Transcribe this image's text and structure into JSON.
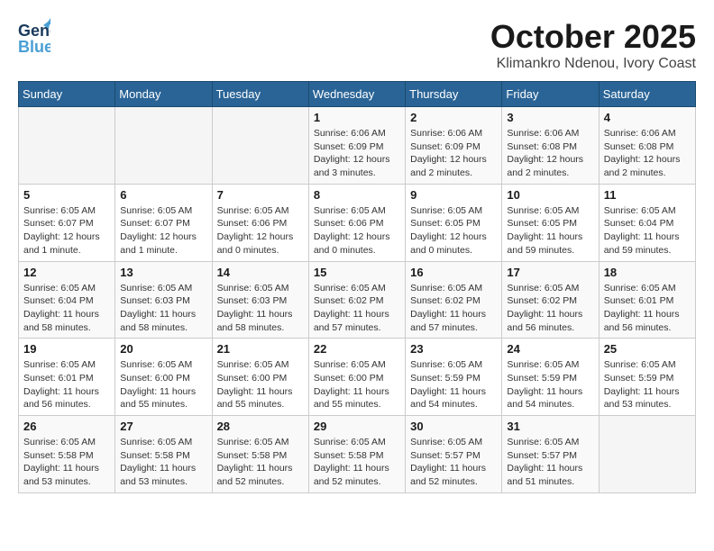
{
  "header": {
    "logo_line1": "General",
    "logo_line2": "Blue",
    "title": "October 2025",
    "subtitle": "Klimankro Ndenou, Ivory Coast"
  },
  "weekdays": [
    "Sunday",
    "Monday",
    "Tuesday",
    "Wednesday",
    "Thursday",
    "Friday",
    "Saturday"
  ],
  "weeks": [
    [
      {
        "day": "",
        "info": ""
      },
      {
        "day": "",
        "info": ""
      },
      {
        "day": "",
        "info": ""
      },
      {
        "day": "1",
        "info": "Sunrise: 6:06 AM\nSunset: 6:09 PM\nDaylight: 12 hours and 3 minutes."
      },
      {
        "day": "2",
        "info": "Sunrise: 6:06 AM\nSunset: 6:09 PM\nDaylight: 12 hours and 2 minutes."
      },
      {
        "day": "3",
        "info": "Sunrise: 6:06 AM\nSunset: 6:08 PM\nDaylight: 12 hours and 2 minutes."
      },
      {
        "day": "4",
        "info": "Sunrise: 6:06 AM\nSunset: 6:08 PM\nDaylight: 12 hours and 2 minutes."
      }
    ],
    [
      {
        "day": "5",
        "info": "Sunrise: 6:05 AM\nSunset: 6:07 PM\nDaylight: 12 hours and 1 minute."
      },
      {
        "day": "6",
        "info": "Sunrise: 6:05 AM\nSunset: 6:07 PM\nDaylight: 12 hours and 1 minute."
      },
      {
        "day": "7",
        "info": "Sunrise: 6:05 AM\nSunset: 6:06 PM\nDaylight: 12 hours and 0 minutes."
      },
      {
        "day": "8",
        "info": "Sunrise: 6:05 AM\nSunset: 6:06 PM\nDaylight: 12 hours and 0 minutes."
      },
      {
        "day": "9",
        "info": "Sunrise: 6:05 AM\nSunset: 6:05 PM\nDaylight: 12 hours and 0 minutes."
      },
      {
        "day": "10",
        "info": "Sunrise: 6:05 AM\nSunset: 6:05 PM\nDaylight: 11 hours and 59 minutes."
      },
      {
        "day": "11",
        "info": "Sunrise: 6:05 AM\nSunset: 6:04 PM\nDaylight: 11 hours and 59 minutes."
      }
    ],
    [
      {
        "day": "12",
        "info": "Sunrise: 6:05 AM\nSunset: 6:04 PM\nDaylight: 11 hours and 58 minutes."
      },
      {
        "day": "13",
        "info": "Sunrise: 6:05 AM\nSunset: 6:03 PM\nDaylight: 11 hours and 58 minutes."
      },
      {
        "day": "14",
        "info": "Sunrise: 6:05 AM\nSunset: 6:03 PM\nDaylight: 11 hours and 58 minutes."
      },
      {
        "day": "15",
        "info": "Sunrise: 6:05 AM\nSunset: 6:02 PM\nDaylight: 11 hours and 57 minutes."
      },
      {
        "day": "16",
        "info": "Sunrise: 6:05 AM\nSunset: 6:02 PM\nDaylight: 11 hours and 57 minutes."
      },
      {
        "day": "17",
        "info": "Sunrise: 6:05 AM\nSunset: 6:02 PM\nDaylight: 11 hours and 56 minutes."
      },
      {
        "day": "18",
        "info": "Sunrise: 6:05 AM\nSunset: 6:01 PM\nDaylight: 11 hours and 56 minutes."
      }
    ],
    [
      {
        "day": "19",
        "info": "Sunrise: 6:05 AM\nSunset: 6:01 PM\nDaylight: 11 hours and 56 minutes."
      },
      {
        "day": "20",
        "info": "Sunrise: 6:05 AM\nSunset: 6:00 PM\nDaylight: 11 hours and 55 minutes."
      },
      {
        "day": "21",
        "info": "Sunrise: 6:05 AM\nSunset: 6:00 PM\nDaylight: 11 hours and 55 minutes."
      },
      {
        "day": "22",
        "info": "Sunrise: 6:05 AM\nSunset: 6:00 PM\nDaylight: 11 hours and 55 minutes."
      },
      {
        "day": "23",
        "info": "Sunrise: 6:05 AM\nSunset: 5:59 PM\nDaylight: 11 hours and 54 minutes."
      },
      {
        "day": "24",
        "info": "Sunrise: 6:05 AM\nSunset: 5:59 PM\nDaylight: 11 hours and 54 minutes."
      },
      {
        "day": "25",
        "info": "Sunrise: 6:05 AM\nSunset: 5:59 PM\nDaylight: 11 hours and 53 minutes."
      }
    ],
    [
      {
        "day": "26",
        "info": "Sunrise: 6:05 AM\nSunset: 5:58 PM\nDaylight: 11 hours and 53 minutes."
      },
      {
        "day": "27",
        "info": "Sunrise: 6:05 AM\nSunset: 5:58 PM\nDaylight: 11 hours and 53 minutes."
      },
      {
        "day": "28",
        "info": "Sunrise: 6:05 AM\nSunset: 5:58 PM\nDaylight: 11 hours and 52 minutes."
      },
      {
        "day": "29",
        "info": "Sunrise: 6:05 AM\nSunset: 5:58 PM\nDaylight: 11 hours and 52 minutes."
      },
      {
        "day": "30",
        "info": "Sunrise: 6:05 AM\nSunset: 5:57 PM\nDaylight: 11 hours and 52 minutes."
      },
      {
        "day": "31",
        "info": "Sunrise: 6:05 AM\nSunset: 5:57 PM\nDaylight: 11 hours and 51 minutes."
      },
      {
        "day": "",
        "info": ""
      }
    ]
  ]
}
